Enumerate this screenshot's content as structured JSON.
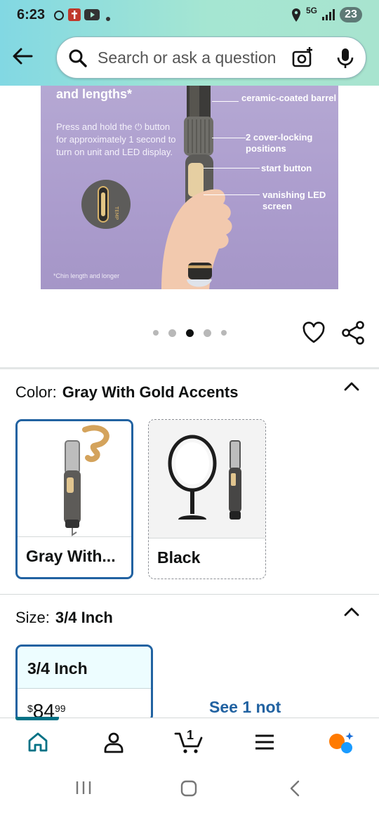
{
  "status_bar": {
    "time": "6:23",
    "network": "5G",
    "battery": "23"
  },
  "search": {
    "placeholder": "Search or ask a question"
  },
  "hero": {
    "heading": "and lengths*",
    "description": "Press and hold the ⏻ button for approximately 1 second to turn on unit and LED display.",
    "footnote": "*Chin length and longer",
    "callouts": {
      "barrel": "ceramic-coated barrel",
      "cover": "2 cover-locking positions",
      "start": "start button",
      "led": "vanishing LED screen"
    }
  },
  "carousel": {
    "total": 5,
    "active_index": 2
  },
  "color": {
    "label": "Color:",
    "value": "Gray With Gold Accents",
    "options": [
      {
        "label": "Gray With...",
        "selected": true
      },
      {
        "label": "Black",
        "selected": false
      }
    ]
  },
  "size": {
    "label": "Size:",
    "value": "3/4 Inch",
    "options": [
      {
        "label": "3/4 Inch",
        "price_symbol": "$",
        "price_whole": "84",
        "price_cents": "99",
        "selected": true
      }
    ],
    "see_not": "See 1 not"
  },
  "bottom_nav": {
    "cart_count": "1"
  },
  "colors": {
    "accent_blue": "#2162a1",
    "teal": "#007185",
    "header_gradient_start": "#82d8e3",
    "header_gradient_end": "#a8e4cf",
    "hero_purple": "#ab9ccd"
  }
}
